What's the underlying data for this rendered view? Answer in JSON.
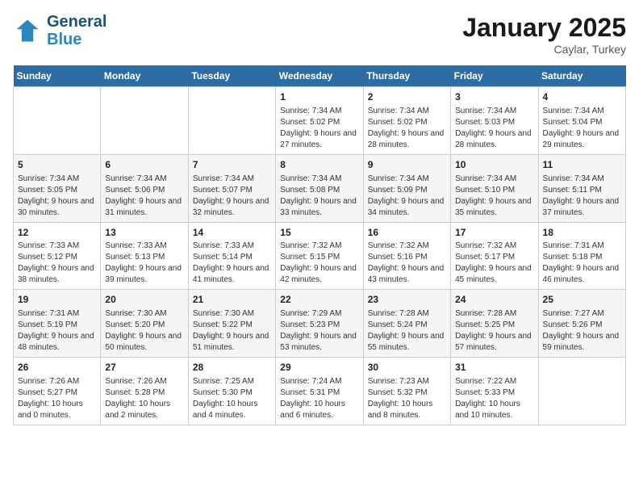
{
  "header": {
    "logo_line1": "General",
    "logo_line2": "Blue",
    "title": "January 2025",
    "location": "Caylar, Turkey"
  },
  "weekdays": [
    "Sunday",
    "Monday",
    "Tuesday",
    "Wednesday",
    "Thursday",
    "Friday",
    "Saturday"
  ],
  "weeks": [
    [
      {
        "day": "",
        "info": ""
      },
      {
        "day": "",
        "info": ""
      },
      {
        "day": "",
        "info": ""
      },
      {
        "day": "1",
        "info": "Sunrise: 7:34 AM\nSunset: 5:02 PM\nDaylight: 9 hours and 27 minutes."
      },
      {
        "day": "2",
        "info": "Sunrise: 7:34 AM\nSunset: 5:02 PM\nDaylight: 9 hours and 28 minutes."
      },
      {
        "day": "3",
        "info": "Sunrise: 7:34 AM\nSunset: 5:03 PM\nDaylight: 9 hours and 28 minutes."
      },
      {
        "day": "4",
        "info": "Sunrise: 7:34 AM\nSunset: 5:04 PM\nDaylight: 9 hours and 29 minutes."
      }
    ],
    [
      {
        "day": "5",
        "info": "Sunrise: 7:34 AM\nSunset: 5:05 PM\nDaylight: 9 hours and 30 minutes."
      },
      {
        "day": "6",
        "info": "Sunrise: 7:34 AM\nSunset: 5:06 PM\nDaylight: 9 hours and 31 minutes."
      },
      {
        "day": "7",
        "info": "Sunrise: 7:34 AM\nSunset: 5:07 PM\nDaylight: 9 hours and 32 minutes."
      },
      {
        "day": "8",
        "info": "Sunrise: 7:34 AM\nSunset: 5:08 PM\nDaylight: 9 hours and 33 minutes."
      },
      {
        "day": "9",
        "info": "Sunrise: 7:34 AM\nSunset: 5:09 PM\nDaylight: 9 hours and 34 minutes."
      },
      {
        "day": "10",
        "info": "Sunrise: 7:34 AM\nSunset: 5:10 PM\nDaylight: 9 hours and 35 minutes."
      },
      {
        "day": "11",
        "info": "Sunrise: 7:34 AM\nSunset: 5:11 PM\nDaylight: 9 hours and 37 minutes."
      }
    ],
    [
      {
        "day": "12",
        "info": "Sunrise: 7:33 AM\nSunset: 5:12 PM\nDaylight: 9 hours and 38 minutes."
      },
      {
        "day": "13",
        "info": "Sunrise: 7:33 AM\nSunset: 5:13 PM\nDaylight: 9 hours and 39 minutes."
      },
      {
        "day": "14",
        "info": "Sunrise: 7:33 AM\nSunset: 5:14 PM\nDaylight: 9 hours and 41 minutes."
      },
      {
        "day": "15",
        "info": "Sunrise: 7:32 AM\nSunset: 5:15 PM\nDaylight: 9 hours and 42 minutes."
      },
      {
        "day": "16",
        "info": "Sunrise: 7:32 AM\nSunset: 5:16 PM\nDaylight: 9 hours and 43 minutes."
      },
      {
        "day": "17",
        "info": "Sunrise: 7:32 AM\nSunset: 5:17 PM\nDaylight: 9 hours and 45 minutes."
      },
      {
        "day": "18",
        "info": "Sunrise: 7:31 AM\nSunset: 5:18 PM\nDaylight: 9 hours and 46 minutes."
      }
    ],
    [
      {
        "day": "19",
        "info": "Sunrise: 7:31 AM\nSunset: 5:19 PM\nDaylight: 9 hours and 48 minutes."
      },
      {
        "day": "20",
        "info": "Sunrise: 7:30 AM\nSunset: 5:20 PM\nDaylight: 9 hours and 50 minutes."
      },
      {
        "day": "21",
        "info": "Sunrise: 7:30 AM\nSunset: 5:22 PM\nDaylight: 9 hours and 51 minutes."
      },
      {
        "day": "22",
        "info": "Sunrise: 7:29 AM\nSunset: 5:23 PM\nDaylight: 9 hours and 53 minutes."
      },
      {
        "day": "23",
        "info": "Sunrise: 7:28 AM\nSunset: 5:24 PM\nDaylight: 9 hours and 55 minutes."
      },
      {
        "day": "24",
        "info": "Sunrise: 7:28 AM\nSunset: 5:25 PM\nDaylight: 9 hours and 57 minutes."
      },
      {
        "day": "25",
        "info": "Sunrise: 7:27 AM\nSunset: 5:26 PM\nDaylight: 9 hours and 59 minutes."
      }
    ],
    [
      {
        "day": "26",
        "info": "Sunrise: 7:26 AM\nSunset: 5:27 PM\nDaylight: 10 hours and 0 minutes."
      },
      {
        "day": "27",
        "info": "Sunrise: 7:26 AM\nSunset: 5:28 PM\nDaylight: 10 hours and 2 minutes."
      },
      {
        "day": "28",
        "info": "Sunrise: 7:25 AM\nSunset: 5:30 PM\nDaylight: 10 hours and 4 minutes."
      },
      {
        "day": "29",
        "info": "Sunrise: 7:24 AM\nSunset: 5:31 PM\nDaylight: 10 hours and 6 minutes."
      },
      {
        "day": "30",
        "info": "Sunrise: 7:23 AM\nSunset: 5:32 PM\nDaylight: 10 hours and 8 minutes."
      },
      {
        "day": "31",
        "info": "Sunrise: 7:22 AM\nSunset: 5:33 PM\nDaylight: 10 hours and 10 minutes."
      },
      {
        "day": "",
        "info": ""
      }
    ]
  ]
}
